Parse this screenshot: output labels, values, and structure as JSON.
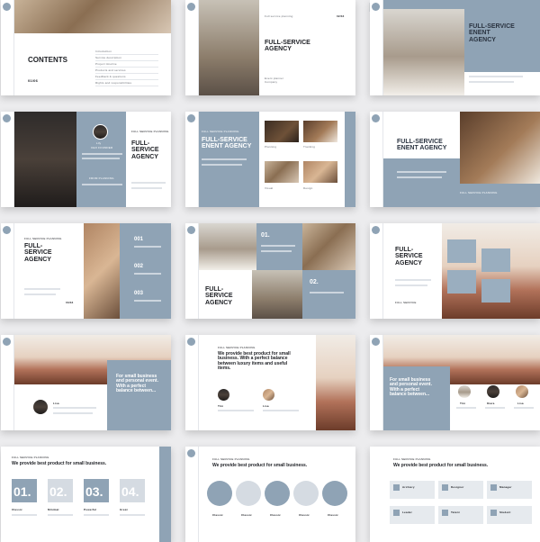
{
  "watermark": "W A T E R M A R K  .  A S T P P T . N E T",
  "colors": {
    "accent": "#8fa3b5",
    "background": "#ececee",
    "dark_text": "#1d1f24"
  },
  "slide1": {
    "heading": "CONTENTS",
    "page": "01/06",
    "items": [
      "Introduction",
      "Service description",
      "Project timeline",
      "Products and services",
      "Feedback & questions",
      "Rights and responsibilities"
    ]
  },
  "slide2": {
    "tag": "Full service planning",
    "page": "02/34",
    "heading": "FULL-SERVICE\nAGENCY",
    "sub": "Event planner\nCompany"
  },
  "slide3": {
    "heading": "FULL-SERVICE\nENENT\nAGENCY"
  },
  "slide4": {
    "tag": "FULL SERVICE PLANNING",
    "heading": "FULL-\nSERVICE\nAGENCY",
    "person": "Lily",
    "person_role": "CEO FOUNDER",
    "section": "FROM PLANNING"
  },
  "slide5": {
    "tag": "FULL SERVICE PLANNING",
    "heading": "FULL-SERVICE\nENENT AGENCY",
    "labels": [
      "Planning",
      "Tracking",
      "Visual",
      "Design"
    ]
  },
  "slide6": {
    "heading": "FULL-SERVICE\nENENT AGENCY",
    "tag": "FULL SERVICE PLANNING"
  },
  "slide7": {
    "tag": "FULL SERVICE PLANNING",
    "heading": "FULL-\nSERVICE\nAGENCY",
    "page": "03/34",
    "numbers": [
      "001",
      "002",
      "003"
    ]
  },
  "slide8": {
    "numbers": [
      "01.",
      "02."
    ],
    "heading": "FULL-\nSERVICE\nAGENCY"
  },
  "slide9": {
    "heading": "FULL-\nSERVICE\nAGENCY",
    "sub": "FULL SERVICE"
  },
  "slide10": {
    "name": "Lisa",
    "text": "For small business\nand personal event.\nWith a perfect\nbalance between..."
  },
  "slide11": {
    "tag": "FULL SERVICE PLANNING",
    "heading": "We provide best product for small\nbusiness. With a perfect balance\nbetween luxury items and useful\nitems.",
    "names": [
      "Trin",
      "Lisa"
    ]
  },
  "slide12": {
    "text": "For small business\nand personal event.\nWith a perfect\nbalance between...",
    "names": [
      "Trin",
      "Kiara",
      "Lisa"
    ]
  },
  "slide13": {
    "tag": "FULL SERVICE PLANNING",
    "heading": "We provide best product for small business.",
    "numbers": [
      "01.",
      "02.",
      "03.",
      "04."
    ],
    "labels": [
      "Classic",
      "Minimal",
      "Powerful",
      "Great"
    ]
  },
  "slide14": {
    "tag": "FULL SERVICE PLANNING",
    "heading": "We provide best product for small business.",
    "labels": [
      "Classic",
      "Classic",
      "Classic",
      "Classic",
      "Classic"
    ]
  },
  "slide15": {
    "tag": "FULL SERVICE PLANNING",
    "heading": "We provide best product for small business.",
    "roles": [
      "Archiery",
      "Designer",
      "Manager",
      "Leader",
      "Talent",
      "Student"
    ]
  }
}
